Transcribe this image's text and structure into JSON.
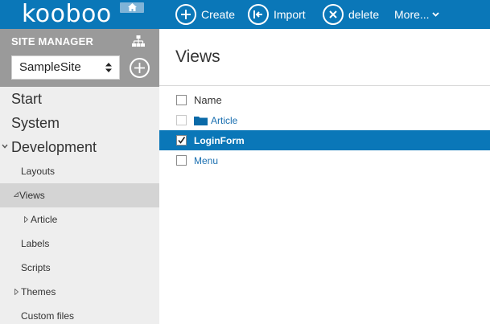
{
  "app": {
    "logo_text": "kooboo"
  },
  "toolbar": {
    "create_label": "Create",
    "import_label": "Import",
    "delete_label": "delete",
    "more_label": "More...",
    "accent_color": "#0a77b8"
  },
  "sidebar": {
    "title": "SITE MANAGER",
    "site_select": {
      "selected": "SampleSite"
    },
    "items": [
      {
        "label": "Start",
        "level": 1
      },
      {
        "label": "System",
        "level": 1
      },
      {
        "label": "Development",
        "level": 1,
        "expanded": true
      },
      {
        "label": "Layouts",
        "level": 2
      },
      {
        "label": "Views",
        "level": 2,
        "expanded": true,
        "active": true
      },
      {
        "label": "Article",
        "level": 3,
        "collapsed": true
      },
      {
        "label": "Labels",
        "level": 2
      },
      {
        "label": "Scripts",
        "level": 2
      },
      {
        "label": "Themes",
        "level": 2,
        "collapsed": true
      },
      {
        "label": "Custom files",
        "level": 2
      }
    ]
  },
  "main": {
    "title": "Views",
    "list_header": "Name",
    "rows": [
      {
        "label": "Article",
        "type": "folder",
        "checked": false
      },
      {
        "label": "LoginForm",
        "type": "view",
        "checked": true,
        "selected": true
      },
      {
        "label": "Menu",
        "type": "view",
        "checked": false
      }
    ]
  }
}
